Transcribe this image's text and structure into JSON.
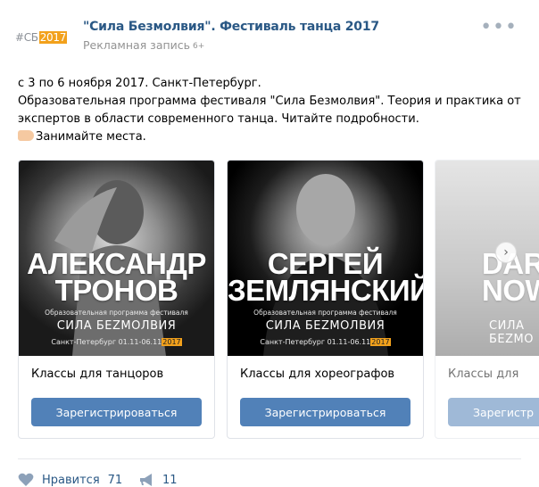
{
  "header": {
    "avatar_text": "#СБ",
    "avatar_highlight": "2017",
    "title": "\"Сила Безмолвия\". Фестиваль танца 2017",
    "subtitle": "Рекламная запись",
    "age_rating": "6+"
  },
  "body": {
    "line1": "с 3 по 6 ноября 2017. Санкт-Петербург.",
    "line2": "Образовательная программа фестиваля \"Сила Безмолвия\". Теория и практика от экспертов в области современного танца. Читайте подробности.",
    "line3": "Занимайте места."
  },
  "cards": [
    {
      "name_line1": "АЛЕКСАНДР",
      "name_line2": "ТРОНОВ",
      "program": "Образовательная программа фестиваля",
      "festival": "СИЛА БЕZМОЛВИЯ",
      "dates": "Санкт-Петербург 01.11-06.11",
      "year": "2017",
      "label": "Классы для танцоров",
      "button": "Зарегистрироваться"
    },
    {
      "name_line1": "СЕРГЕЙ",
      "name_line2": "ЗЕМЛЯНСКИЙ",
      "program": "Образовательная программа фестиваля",
      "festival": "СИЛА БЕZМОЛВИЯ",
      "dates": "Санкт-Петербург 01.11-06.11",
      "year": "2017",
      "label": "Классы для хореографов",
      "button": "Зарегистрироваться"
    },
    {
      "name_line1": "DARI",
      "name_line2": "NOW",
      "festival": "СИЛА БЕZМО",
      "label": "Классы для",
      "button": "Зарегистр"
    }
  ],
  "footer": {
    "like_label": "Нравится",
    "like_count": "71",
    "share_count": "11"
  },
  "colors": {
    "link": "#2a5885",
    "button": "#5181b8",
    "accent": "#f2a11c",
    "muted": "#939393"
  },
  "icons": [
    "more-dots-icon",
    "pointing-hand-icon",
    "chevron-right-icon",
    "heart-icon",
    "megaphone-icon"
  ]
}
